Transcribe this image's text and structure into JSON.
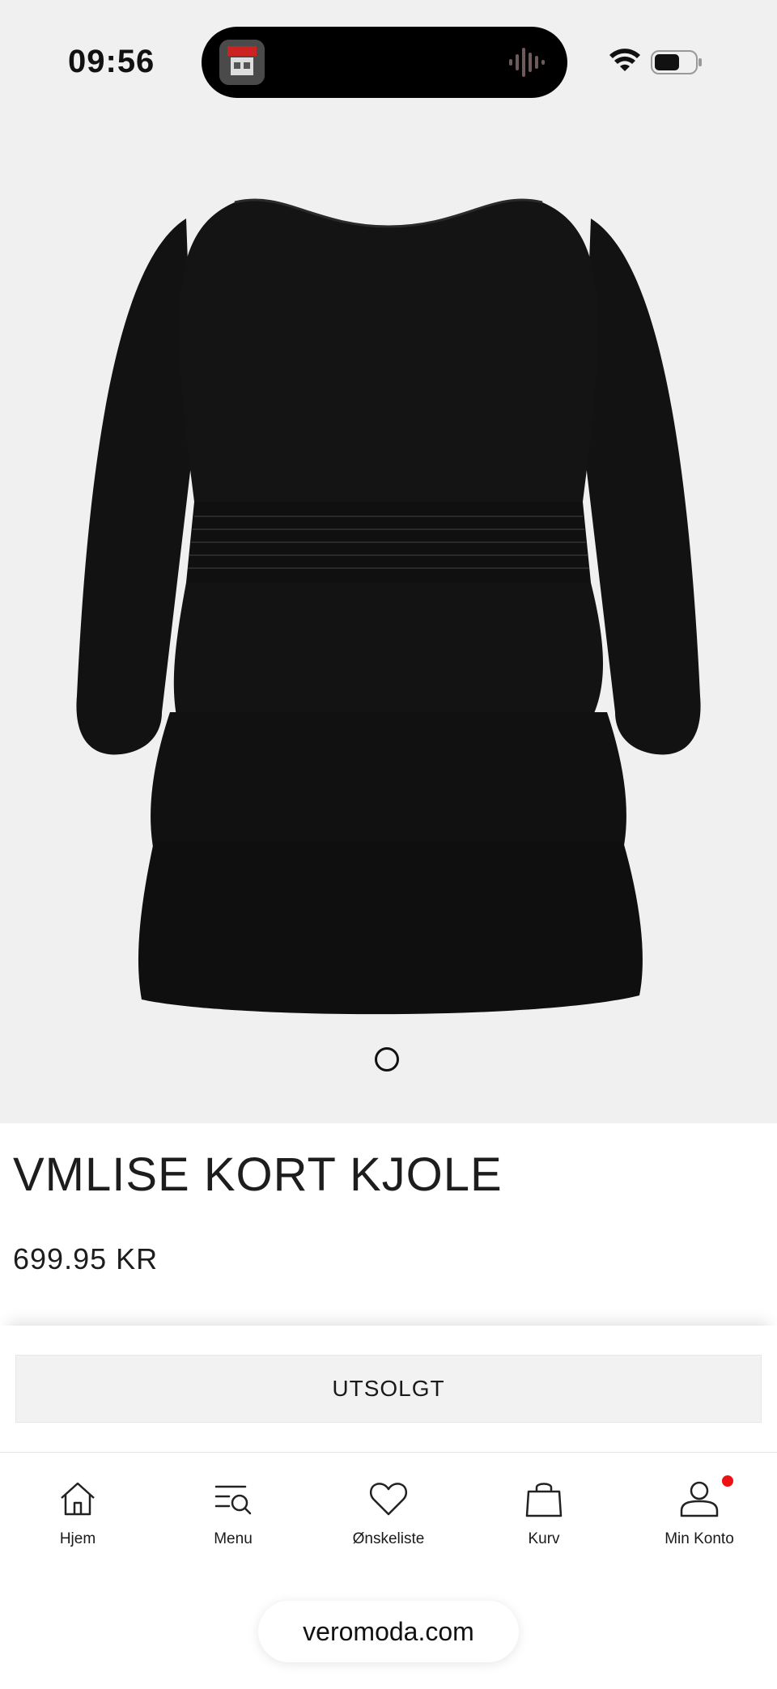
{
  "status_bar": {
    "time": "09:56"
  },
  "product": {
    "title": "VMLISE KORT KJOLE",
    "price": "699.95 KR",
    "image_icon": "dress-image",
    "button_label": "UTSOLGT"
  },
  "nav": {
    "items": [
      {
        "label": "Hjem",
        "icon": "home-icon"
      },
      {
        "label": "Menu",
        "icon": "menu-search-icon"
      },
      {
        "label": "Ønskeliste",
        "icon": "heart-icon"
      },
      {
        "label": "Kurv",
        "icon": "bag-icon"
      },
      {
        "label": "Min Konto",
        "icon": "user-icon"
      }
    ]
  },
  "browser": {
    "url": "veromoda.com"
  },
  "colors": {
    "notification": "#ee1111",
    "background": "#f0f0f0",
    "button_bg": "#f1f2f1"
  }
}
